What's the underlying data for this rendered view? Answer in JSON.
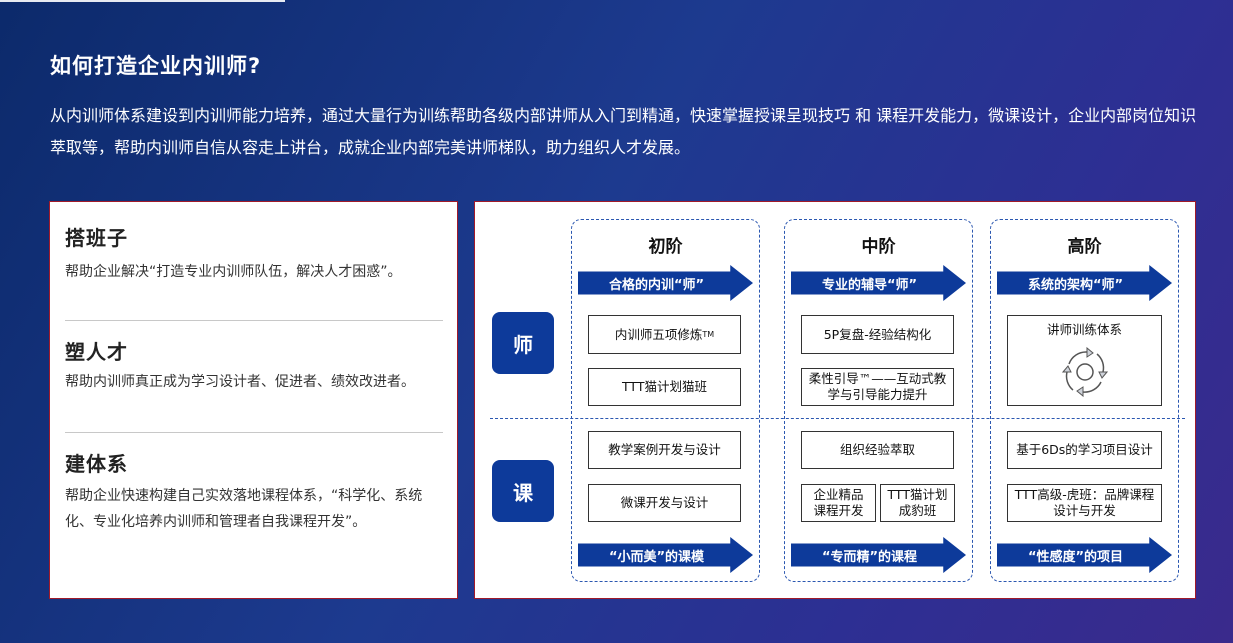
{
  "title": "如何打造企业内训师?",
  "intro": "从内训师体系建设到内训师能力培养，通过大量行为训练帮助各级内部讲师从入门到精通，快速掌握授课呈现技巧 和 课程开发能力，微课设计，企业内部岗位知识萃取等，帮助内训师自信从容走上讲台，成就企业内部完美讲师梯队，助力组织人才发展。",
  "left": {
    "sections": [
      {
        "title": "搭班子",
        "desc": "帮助企业解决“打造专业内训师队伍，解决人才困惑”。"
      },
      {
        "title": "塑人才",
        "desc": "帮助内训师真正成为学习设计者、促进者、绩效改进者。"
      },
      {
        "title": "建体系",
        "desc": "帮助企业快速构建自己实效落地课程体系，“科学化、系统化、专业化培养内训师和管理者自我课程开发”。"
      }
    ]
  },
  "roles": {
    "teacher": "师",
    "course": "课"
  },
  "levels": [
    {
      "name": "初阶",
      "top_arrow": "合格的内训“师”",
      "teacher_items": [
        "内训师五项修炼",
        "TTT猫计划猫班"
      ],
      "teacher_item1_sup": "TM",
      "course_items": [
        "教学案例开发与设计",
        "微课开发与设计"
      ],
      "bottom_arrow": "“小而美”的课模"
    },
    {
      "name": "中阶",
      "top_arrow": "专业的辅导“师”",
      "teacher_items": [
        "5P复盘-经验结构化",
        "柔性引导™——互动式教学与引导能力提升"
      ],
      "course_items": [
        "组织经验萃取",
        "企业精品课程开发",
        "TTT猫计划成豹班"
      ],
      "bottom_arrow": "“专而精”的课程"
    },
    {
      "name": "高阶",
      "top_arrow": "系统的架构“师”",
      "teacher_items": [
        "讲师训练体系"
      ],
      "teacher_icon": "cycle-arrows-icon",
      "course_items": [
        "基于6Ds的学习项目设计",
        "TTT高级-虎班：品牌课程设计与开发"
      ],
      "bottom_arrow": "“性感度”的项目"
    }
  ],
  "colors": {
    "accent": "#0d3a9a",
    "border": "#a01a2a",
    "dashed": "#2b57b0"
  }
}
